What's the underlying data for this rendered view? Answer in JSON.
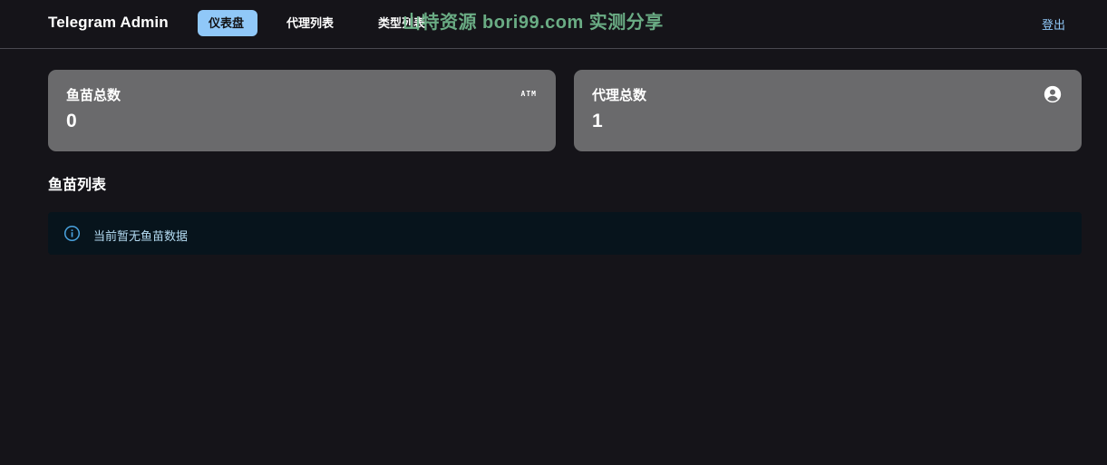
{
  "header": {
    "brand": "Telegram Admin",
    "nav": {
      "dashboard": "仪表盘",
      "agents": "代理列表",
      "types": "类型列表"
    },
    "watermark": "山特资源 bori99.com 实测分享",
    "logout": "登出"
  },
  "cards": {
    "fish": {
      "title": "鱼苗总数",
      "value": "0",
      "icon_text": "ATM",
      "icon": "atm-icon"
    },
    "agents": {
      "title": "代理总数",
      "value": "1",
      "icon": "account-circle-icon"
    }
  },
  "list": {
    "title": "鱼苗列表",
    "empty_message": "当前暂无鱼苗数据",
    "icon": "info-icon"
  },
  "colors": {
    "background": "#151419",
    "card": "#6a6a6c",
    "active_nav": "#90c8f8",
    "alert_bg": "#07141c",
    "alert_text": "#b5dcf3",
    "watermark": "#6fb58a"
  }
}
